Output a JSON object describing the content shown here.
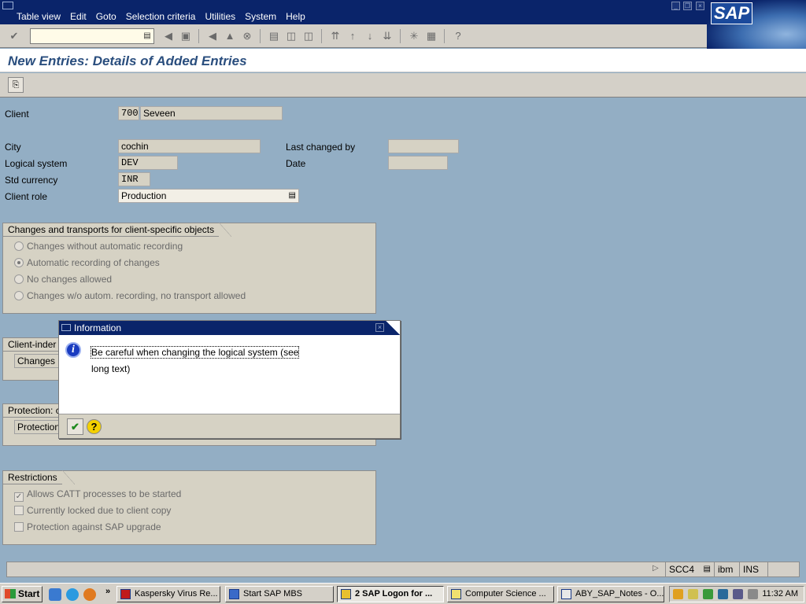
{
  "menu": [
    "Table view",
    "Edit",
    "Goto",
    "Selection criteria",
    "Utilities",
    "System",
    "Help"
  ],
  "window_buttons": {
    "minimize": "_",
    "restore": "❐",
    "close": "×"
  },
  "logo_text": "SAP",
  "toolbar": {
    "command_field_value": "",
    "command_field_dd": "▤"
  },
  "page_title": "New Entries: Details of Added Entries",
  "form": {
    "client_label": "Client",
    "client_value": "700",
    "client_name": "Seveen",
    "city_label": "City",
    "city_value": "cochin",
    "logical_system_label": "Logical system",
    "logical_system_value": "DEV",
    "std_currency_label": "Std currency",
    "std_currency_value": "INR",
    "client_role_label": "Client role",
    "client_role_value": "Production",
    "last_changed_by_label": "Last changed by",
    "last_changed_by_value": "",
    "date_label": "Date",
    "date_value": ""
  },
  "changes_group": {
    "title": "Changes and transports for client-specific objects",
    "options": [
      {
        "label": "Changes without automatic recording",
        "selected": false
      },
      {
        "label": "Automatic recording of changes",
        "selected": true
      },
      {
        "label": "No changes allowed",
        "selected": false
      },
      {
        "label": "Changes w/o autom. recording, no transport allowed",
        "selected": false
      }
    ]
  },
  "client_independent_group": {
    "title": "Client-inder",
    "field": "Changes"
  },
  "protection_group": {
    "title": "Protection: c",
    "field": "Protection"
  },
  "restrictions_group": {
    "title": "Restrictions",
    "options": [
      {
        "label": "Allows CATT processes to be started",
        "checked": true
      },
      {
        "label": "Currently locked due to client copy",
        "checked": false
      },
      {
        "label": "Protection against SAP upgrade",
        "checked": false
      }
    ]
  },
  "dialog": {
    "title": "Information",
    "message_line1": "Be careful when changing the logical system (see",
    "message_line2": "long text)",
    "ok_icon": "✔",
    "help_icon": "?"
  },
  "statusbar": {
    "transaction": "SCC4",
    "server": "ibm",
    "mode": "INS"
  },
  "taskbar": {
    "start_label": "Start",
    "tasks": [
      {
        "label": "Kaspersky Virus Re...",
        "active": false
      },
      {
        "label": "Start SAP MBS",
        "active": false
      },
      {
        "label": "2 SAP Logon for ...",
        "active": true
      },
      {
        "label": "Computer Science ...",
        "active": false
      },
      {
        "label": "ABY_SAP_Notes - O...",
        "active": false
      }
    ],
    "clock": "11:32 AM"
  },
  "colors": {
    "title_bar": "#0a246a",
    "page_title": "#2a4e7e",
    "background": "#93aec4",
    "panel": "#d6d2c4"
  }
}
